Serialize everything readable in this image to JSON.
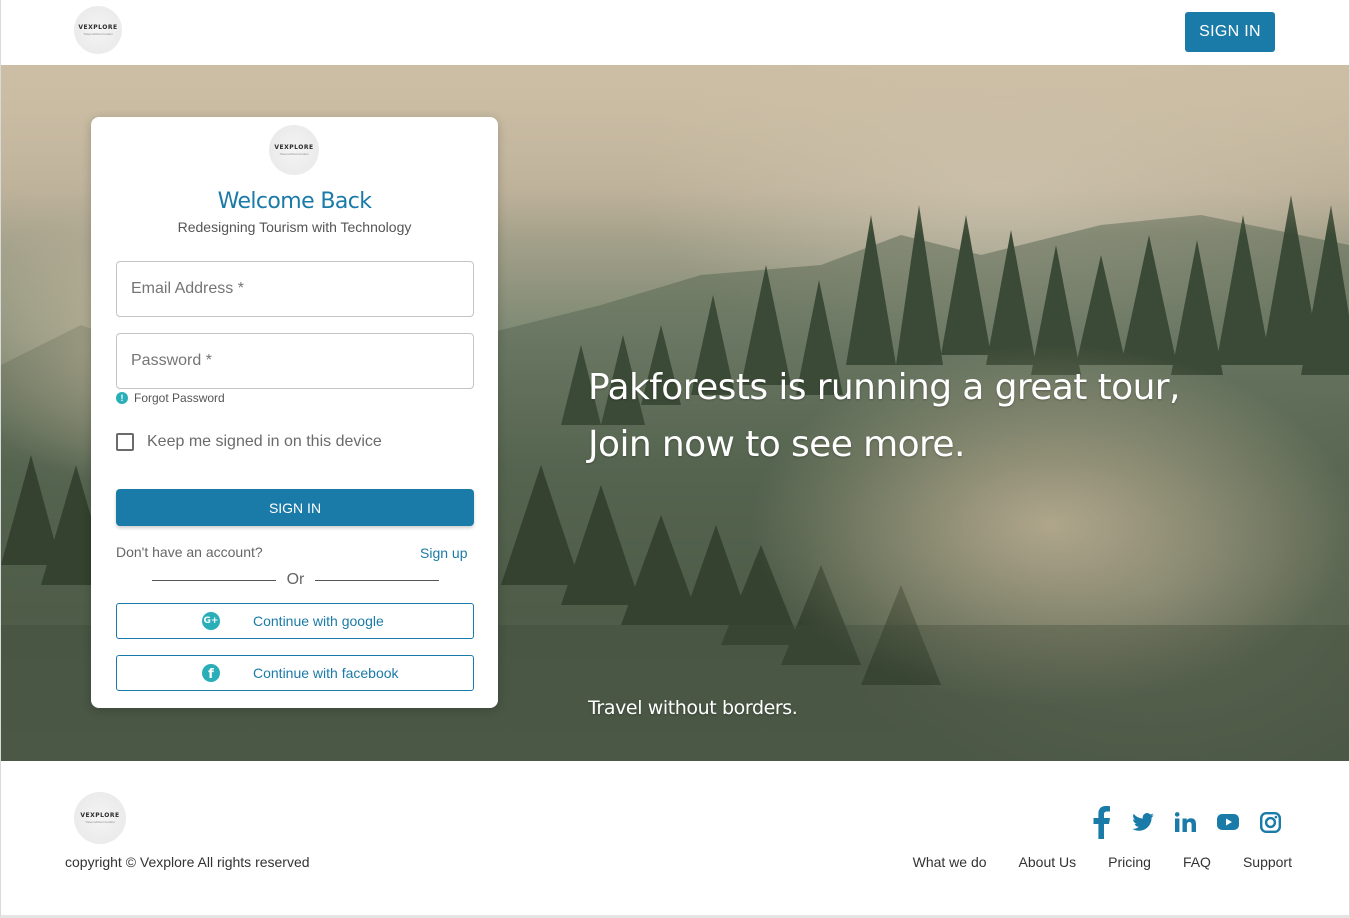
{
  "header": {
    "logo_brand": "VEXPLORE",
    "logo_tagline": "Travel without borders",
    "signin_label": "SIGN IN"
  },
  "hero": {
    "headline_line1": "Pakforests is running a great tour,",
    "headline_line2": "Join now to see more.",
    "tagline": "Travel without borders."
  },
  "login": {
    "title": "Welcome Back",
    "subtitle": "Redesigning Tourism with Technology",
    "email_placeholder": "Email Address *",
    "email_value": "",
    "password_placeholder": "Password *",
    "password_value": "",
    "forgot_label": "Forgot Password",
    "keep_signed_label": "Keep me signed in on this device",
    "keep_signed_checked": false,
    "signin_label": "SIGN IN",
    "no_account_text": "Don't have an account?",
    "signup_label": "Sign up",
    "or_text": "Or",
    "google_label": "Continue with google",
    "facebook_label": "Continue with facebook"
  },
  "footer": {
    "copyright": "copyright © Vexplore All rights reserved",
    "social": [
      "facebook-icon",
      "twitter-icon",
      "linkedin-icon",
      "youtube-icon",
      "instagram-icon"
    ],
    "links": [
      "What we do",
      "About Us",
      "Pricing",
      "FAQ",
      "Support"
    ]
  },
  "colors": {
    "primary": "#1a7aa8",
    "accent": "#2aaeb8",
    "text": "#333333"
  }
}
